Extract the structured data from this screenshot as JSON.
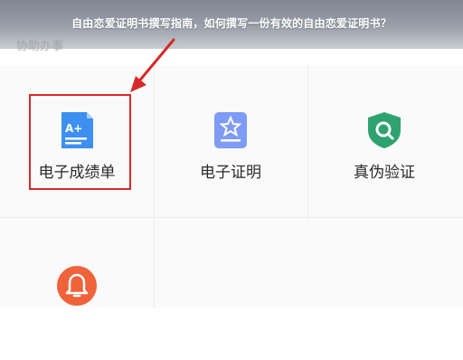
{
  "header": {
    "title": "自由恋爱证明书撰写指南，如何撰写一份有效的自由恋爱证明书？",
    "section_label": "协助办事"
  },
  "grid": {
    "items": [
      {
        "label": "电子成绩单",
        "icon": "transcript-icon",
        "color": "#3d8ff0"
      },
      {
        "label": "电子证明",
        "icon": "certificate-star-icon",
        "color": "#6f8ff5"
      },
      {
        "label": "真伪验证",
        "icon": "shield-search-icon",
        "color": "#2ea36f"
      },
      {
        "label": "",
        "icon": "bell-icon",
        "color": "#f0623a"
      }
    ]
  },
  "annotation": {
    "highlight_color": "#d62a2a"
  }
}
